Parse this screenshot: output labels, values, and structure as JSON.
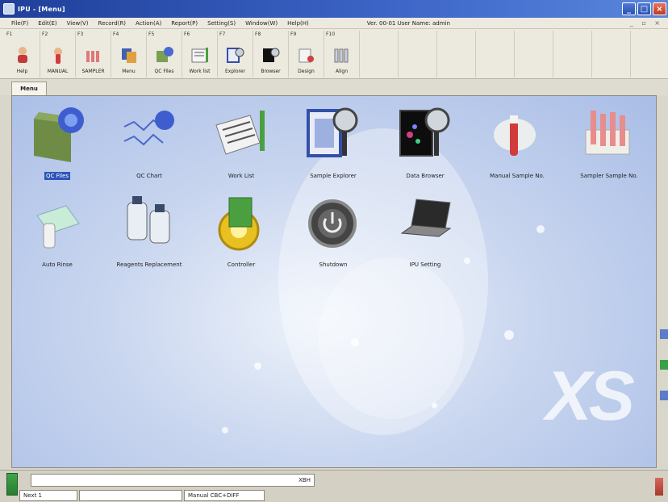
{
  "window": {
    "title": "IPU - [Menu]"
  },
  "menubar": {
    "items": [
      "File(F)",
      "Edit(E)",
      "View(V)",
      "Record(R)",
      "Action(A)",
      "Report(P)",
      "Setting(S)",
      "Window(W)",
      "Help(H)"
    ],
    "user_info": "Ver. 00-01  User Name: admin"
  },
  "toolbar": {
    "buttons": [
      {
        "fkey": "F1",
        "label": "Help",
        "icon": "help-icon"
      },
      {
        "fkey": "F2",
        "label": "MANUAL",
        "icon": "manual-tube-icon"
      },
      {
        "fkey": "F3",
        "label": "SAMPLER",
        "icon": "sampler-icon"
      },
      {
        "fkey": "F4",
        "label": "Menu",
        "icon": "menu-icon"
      },
      {
        "fkey": "F5",
        "label": "QC Files",
        "icon": "qc-files-icon"
      },
      {
        "fkey": "F6",
        "label": "Work list",
        "icon": "work-list-icon"
      },
      {
        "fkey": "F7",
        "label": "Explorer",
        "icon": "explorer-icon"
      },
      {
        "fkey": "F8",
        "label": "Browser",
        "icon": "browser-icon"
      },
      {
        "fkey": "F9",
        "label": "Design",
        "icon": "design-icon"
      },
      {
        "fkey": "F10",
        "label": "Align",
        "icon": "align-icon"
      }
    ]
  },
  "tab": {
    "label": "Menu"
  },
  "launchers": [
    {
      "label": "QC Files",
      "icon": "qc-files-icon",
      "selected": true
    },
    {
      "label": "QC Chart",
      "icon": "qc-chart-icon"
    },
    {
      "label": "Work List",
      "icon": "work-list-icon"
    },
    {
      "label": "Sample Explorer",
      "icon": "sample-explorer-icon"
    },
    {
      "label": "Data Browser",
      "icon": "data-browser-icon"
    },
    {
      "label": "Manual Sample No.",
      "icon": "manual-sample-icon"
    },
    {
      "label": "Sampler Sample No.",
      "icon": "sampler-sample-icon"
    },
    {
      "label": "Auto Rinse",
      "icon": "auto-rinse-icon"
    },
    {
      "label": "Reagents Replacement",
      "icon": "reagents-icon"
    },
    {
      "label": "Controller",
      "icon": "controller-gear-icon"
    },
    {
      "label": "Shutdown",
      "icon": "power-icon"
    },
    {
      "label": "IPU Setting",
      "icon": "laptop-icon"
    }
  ],
  "background": {
    "logo_text": "XS"
  },
  "statusbar": {
    "input_value": "XBH",
    "cells": [
      "Next 1",
      "",
      "Manual  CBC+DIFF"
    ]
  },
  "colors": {
    "title_bar": "#2d55b8",
    "selected_label": "#2d55b8",
    "workspace": "#c9d6ef"
  }
}
